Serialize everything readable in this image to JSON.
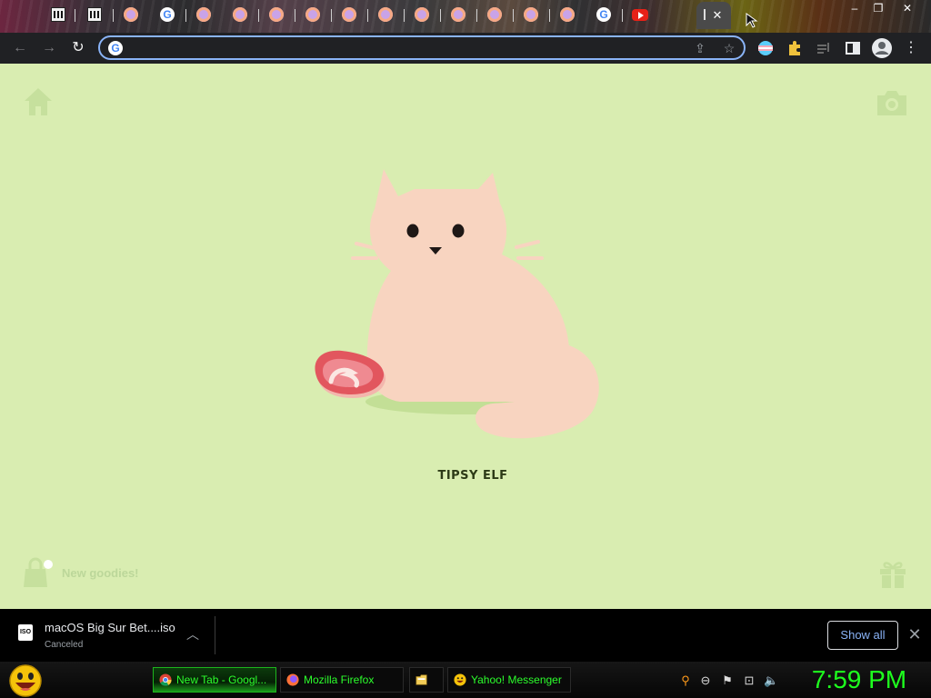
{
  "browser": {
    "tabs": [
      {
        "icon": "archive-icon"
      },
      {
        "icon": "archive-icon"
      },
      {
        "icon": "cat-favicon-icon"
      },
      {
        "icon": "google-icon"
      },
      {
        "icon": "cat-favicon-icon"
      },
      {
        "icon": "cat-favicon-icon"
      },
      {
        "icon": "cat-favicon-icon"
      },
      {
        "icon": "cat-favicon-icon"
      },
      {
        "icon": "cat-favicon-icon"
      },
      {
        "icon": "cat-favicon-icon"
      },
      {
        "icon": "cat-favicon-icon"
      },
      {
        "icon": "cat-favicon-icon"
      },
      {
        "icon": "cat-favicon-icon"
      },
      {
        "icon": "cat-favicon-icon"
      },
      {
        "icon": "cat-favicon-icon"
      },
      {
        "icon": "google-icon"
      },
      {
        "icon": "youtube-icon"
      }
    ],
    "active_tab_close": "✕",
    "window_controls": {
      "minimize": "–",
      "maximize": "❐",
      "close": "✕"
    },
    "address_bar": {
      "value": "",
      "placeholder": ""
    },
    "toolbar_icons": [
      "back-icon",
      "forward-icon",
      "reload-icon",
      "share-icon",
      "bookmark-star-icon",
      "profile-flag-icon",
      "extensions-icon",
      "media-icon",
      "side-panel-icon",
      "account-icon",
      "menu-icon"
    ]
  },
  "page": {
    "background": "#d9edb1",
    "pet_name": "TIPSY ELF",
    "goodies_label": "New goodies!"
  },
  "downloads": {
    "filename": "macOS Big Sur Bet....iso",
    "status": "Canceled",
    "file_type": "ISO",
    "show_all_label": "Show all"
  },
  "taskbar": {
    "buttons": [
      {
        "label": "New Tab - Googl...",
        "icon": "chrome-icon",
        "active": true
      },
      {
        "label": "Mozilla Firefox",
        "icon": "firefox-icon",
        "active": false
      },
      {
        "label": "",
        "icon": "folder-icon",
        "active": false
      },
      {
        "label": "Yahoo! Messenger",
        "icon": "yahoo-messenger-icon",
        "active": false
      }
    ],
    "clock": "7:59 PM",
    "accent": "#1eff1e"
  }
}
